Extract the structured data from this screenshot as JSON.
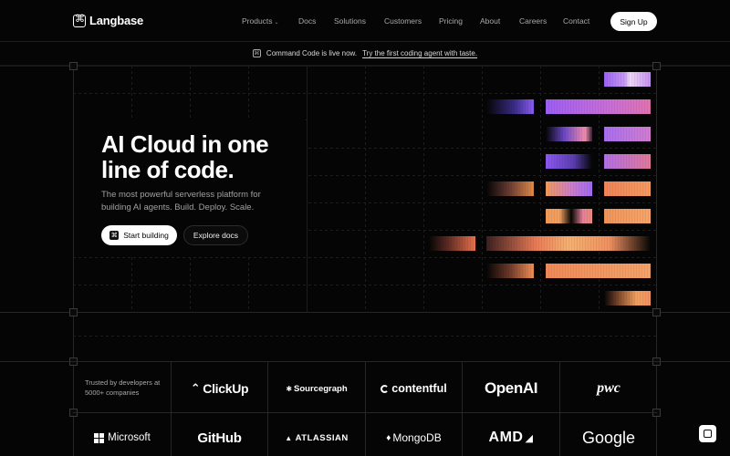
{
  "brand": {
    "name": "Langbase"
  },
  "nav": {
    "items": [
      {
        "label": "Products",
        "has_caret": true
      },
      {
        "label": "Docs"
      },
      {
        "label": "Solutions"
      },
      {
        "label": "Customers"
      },
      {
        "label": "Pricing"
      },
      {
        "label": "About"
      },
      {
        "label": "Careers"
      },
      {
        "label": "Contact"
      }
    ],
    "cta": "Sign Up"
  },
  "announcement": {
    "text": "Command Code is live now.",
    "link": "Try the first coding agent with taste."
  },
  "hero": {
    "title": "AI Cloud in one line of code.",
    "subtitle": "The most powerful serverless platform for building AI agents. Build. Deploy. Scale.",
    "primary_cta": "Start building",
    "secondary_cta": "Explore docs"
  },
  "trust": {
    "label": "Trusted by developers at 5000+ companies",
    "logos_row1": [
      "ClickUp",
      "Sourcegraph",
      "contentful",
      "OpenAI",
      "pwc"
    ],
    "logos_row2": [
      "Microsoft",
      "GitHub",
      "ATLASSIAN",
      "MongoDB",
      "AMD",
      "Google"
    ]
  },
  "colors": {
    "background": "#050505",
    "accent_purple": "#a066f0",
    "accent_pink": "#e8788a",
    "accent_orange": "#f0955a"
  },
  "icons": [
    "logo-mark-icon",
    "command-icon",
    "chevron-down-icon",
    "chat-icon"
  ]
}
